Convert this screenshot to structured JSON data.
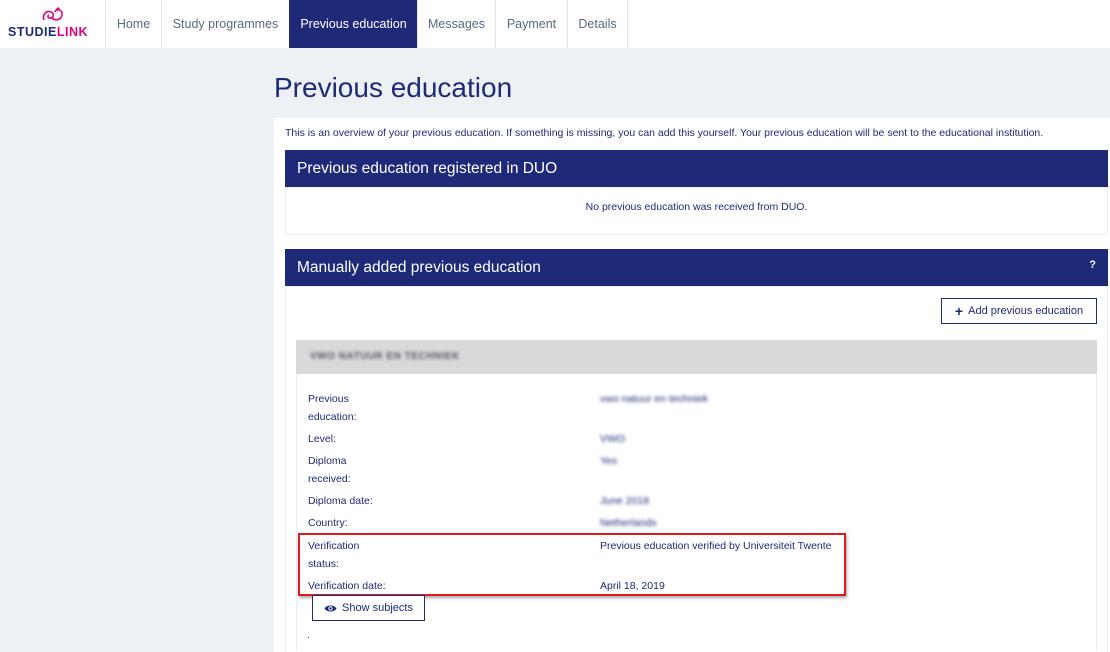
{
  "brand": {
    "logo_prefix": "STUDIE",
    "logo_suffix": "LINK",
    "accent_color": "#1e2a78",
    "logo_color": "#e6007e"
  },
  "nav": {
    "items": [
      {
        "label": "Home",
        "active": false
      },
      {
        "label": "Study programmes",
        "active": false
      },
      {
        "label": "Previous education",
        "active": true
      },
      {
        "label": "Messages",
        "active": false
      },
      {
        "label": "Payment",
        "active": false
      },
      {
        "label": "Details",
        "active": false
      }
    ]
  },
  "page": {
    "title": "Previous education",
    "intro": "This is an overview of your previous education. If something is missing, you can add this yourself. Your previous education will be sent to the educational institution."
  },
  "duo_panel": {
    "title": "Previous education registered in DUO",
    "message": "No previous education was received from DUO."
  },
  "manual_panel": {
    "title": "Manually added previous education",
    "help": "?",
    "add_button": "Add previous education",
    "record": {
      "header": "VWO NATUUR EN TECHNIEK",
      "fields": [
        {
          "label_1": "Previous",
          "label_2": "education:",
          "value": "vwo natuur en techniek",
          "blurred": true
        },
        {
          "label_1": "Level:",
          "label_2": "",
          "value": "VWO",
          "blurred": true
        },
        {
          "label_1": "Diploma",
          "label_2": "received:",
          "value": "Yes",
          "blurred": true
        },
        {
          "label_1": "Diploma date:",
          "label_2": "",
          "value": "June 2018",
          "blurred": true
        },
        {
          "label_1": "Country:",
          "label_2": "",
          "value": "Netherlands",
          "blurred": true
        },
        {
          "label_1": "Verification",
          "label_2": "status:",
          "value": "Previous education verified by Universiteit Twente",
          "blurred": false
        },
        {
          "label_1": "Verification date:",
          "label_2": "",
          "value": "April 18, 2019",
          "blurred": false
        }
      ],
      "show_subjects_button": "Show subjects",
      "trailing": "."
    }
  }
}
